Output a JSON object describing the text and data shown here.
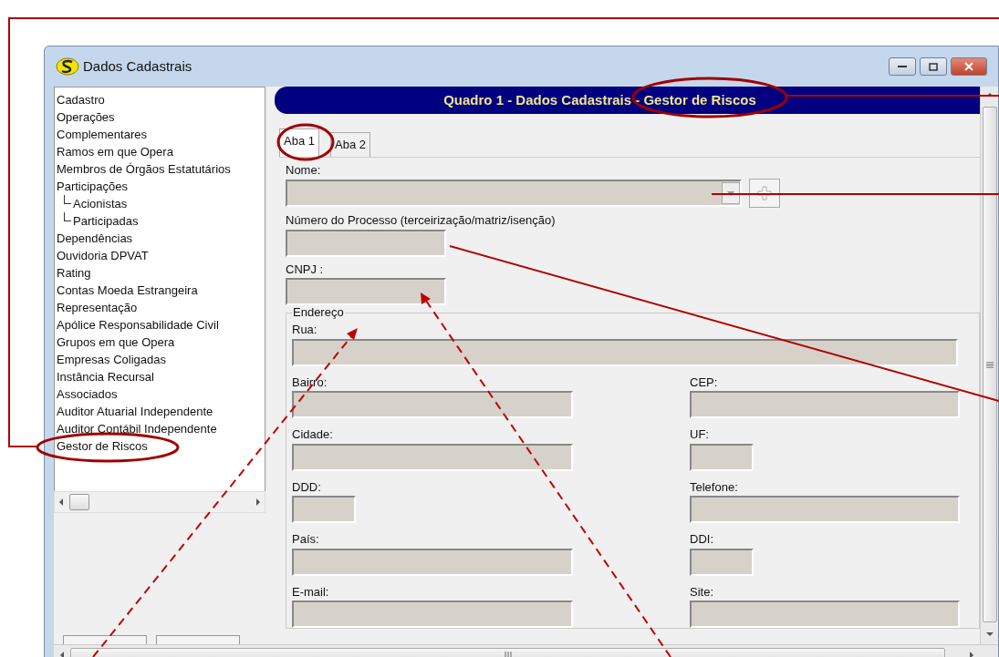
{
  "window": {
    "title": "Dados Cadastrais"
  },
  "sidebar": {
    "items": [
      {
        "label": "Cadastro"
      },
      {
        "label": "Operações"
      },
      {
        "label": "Complementares"
      },
      {
        "label": "Ramos em que Opera"
      },
      {
        "label": "Membros de Órgãos Estatutários"
      },
      {
        "label": "Participações",
        "children": [
          {
            "label": "Acionistas"
          },
          {
            "label": "Participadas"
          }
        ]
      },
      {
        "label": "Dependências"
      },
      {
        "label": "Ouvidoria DPVAT"
      },
      {
        "label": "Rating"
      },
      {
        "label": "Contas Moeda Estrangeira"
      },
      {
        "label": "Representação"
      },
      {
        "label": "Apólice Responsabilidade Civil"
      },
      {
        "label": "Grupos em que Opera"
      },
      {
        "label": "Empresas Coligadas"
      },
      {
        "label": "Instância Recursal"
      },
      {
        "label": "Associados"
      },
      {
        "label": "Auditor Atuarial Independente"
      },
      {
        "label": "Auditor Contábil Independente"
      },
      {
        "label": "Gestor de Riscos"
      }
    ]
  },
  "header": {
    "title": "Quadro 1 - Dados Cadastrais - Gestor de Riscos"
  },
  "tabs": [
    {
      "label": "Aba 1",
      "selected": true
    },
    {
      "label": "Aba 2",
      "selected": false
    }
  ],
  "fields": [
    {
      "label": "Nome:",
      "kind": "combo"
    },
    {
      "label": "Número do Processo (terceirização/matriz/isenção)",
      "kind": "short"
    },
    {
      "label": "CNPJ :",
      "kind": "short"
    }
  ],
  "address": {
    "legend": "Endereço",
    "street": {
      "label": "Rua:"
    },
    "rows": [
      [
        {
          "label": "Bairro:",
          "kind": "long"
        },
        {
          "label": "CEP:",
          "kind": "long"
        }
      ],
      [
        {
          "label": "Cidade:",
          "kind": "long"
        },
        {
          "label": "UF:",
          "kind": "short"
        }
      ],
      [
        {
          "label": "DDD:",
          "kind": "short"
        },
        {
          "label": "Telefone:",
          "kind": "long"
        }
      ],
      [
        {
          "label": "País:",
          "kind": "long"
        },
        {
          "label": "DDI:",
          "kind": "short"
        }
      ],
      [
        {
          "label": "E-mail:",
          "kind": "long"
        },
        {
          "label": "Site:",
          "kind": "long"
        }
      ]
    ]
  }
}
